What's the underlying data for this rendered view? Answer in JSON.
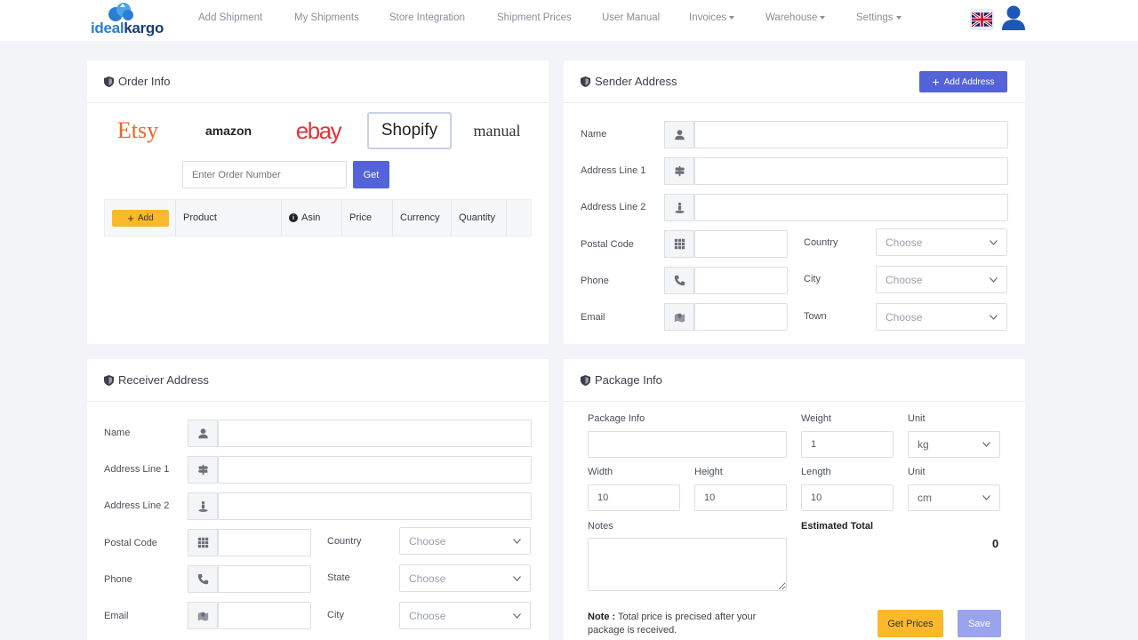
{
  "brand": {
    "name_part1": "ideal",
    "name_part2": "kargo"
  },
  "nav": {
    "items": [
      {
        "label": "Add Shipment",
        "dropdown": false
      },
      {
        "label": "My Shipments",
        "dropdown": false
      },
      {
        "label": "Store Integration",
        "dropdown": false
      },
      {
        "label": "Shipment Prices",
        "dropdown": false
      },
      {
        "label": "User Manual",
        "dropdown": false
      },
      {
        "label": "Invoices",
        "dropdown": true
      },
      {
        "label": "Warehouse",
        "dropdown": true
      },
      {
        "label": "Settings",
        "dropdown": true
      }
    ],
    "language_icon": "uk-flag-icon",
    "account_icon": "user-icon"
  },
  "order_info": {
    "title": "Order Info",
    "marketplaces": [
      {
        "label": "Etsy",
        "selected": false,
        "color": "#f1641e"
      },
      {
        "label": "amazon",
        "selected": false,
        "color": "#222222"
      },
      {
        "label": "ebay",
        "selected": false,
        "color": "#e53238"
      },
      {
        "label": "Shopify",
        "selected": true,
        "color": "#222222"
      },
      {
        "label": "manual",
        "selected": false,
        "color": "#333333"
      }
    ],
    "order_number_placeholder": "Enter Order Number",
    "get_label": "Get",
    "add_label": "Add",
    "columns": [
      "Product",
      "Asin",
      "Price",
      "Currency",
      "Quantity"
    ]
  },
  "sender": {
    "title": "Sender Address",
    "add_address_label": "Add Address",
    "name_label": "Name",
    "address1_label": "Address Line 1",
    "address2_label": "Address Line 2",
    "postal_label": "Postal Code",
    "phone_label": "Phone",
    "email_label": "Email",
    "country_label": "Country",
    "city_label": "City",
    "town_label": "Town",
    "choose": "Choose"
  },
  "receiver": {
    "title": "Receiver Address",
    "name_label": "Name",
    "address1_label": "Address Line 1",
    "address2_label": "Address Line 2",
    "postal_label": "Postal Code",
    "phone_label": "Phone",
    "email_label": "Email",
    "country_label": "Country",
    "state_label": "State",
    "city_label": "City",
    "choose": "Choose"
  },
  "package": {
    "title": "Package Info",
    "package_info_label": "Package Info",
    "weight_label": "Weight",
    "weight_value": "1",
    "unit_label": "Unit",
    "weight_unit": "kg",
    "width_label": "Width",
    "width_value": "10",
    "height_label": "Height",
    "height_value": "10",
    "length_label": "Length",
    "length_value": "10",
    "length_unit": "cm",
    "notes_label": "Notes",
    "estimated_total_label": "Estimated Total",
    "estimated_total_value": "0",
    "note_prefix": "Note :",
    "note_text": " Total price is precised after your",
    "note_text2": "package is received.",
    "get_prices_label": "Get Prices",
    "save_label": "Save"
  },
  "colors": {
    "primary": "#5563d9",
    "warning": "#fbb829",
    "save_disabled": "#9aa3ee"
  }
}
